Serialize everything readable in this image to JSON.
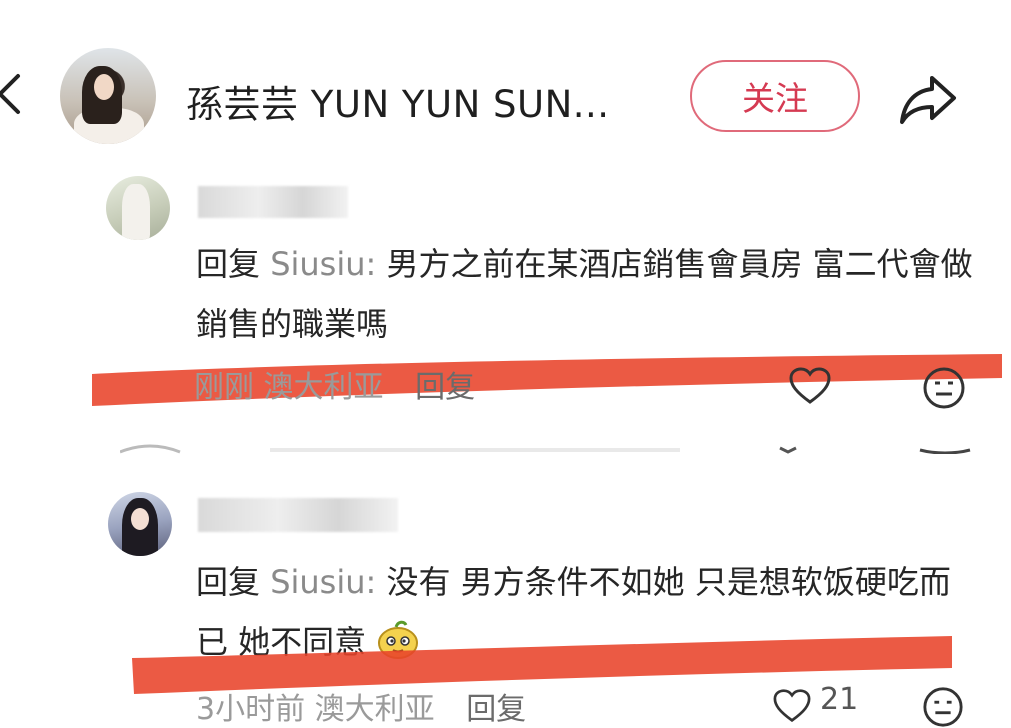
{
  "header": {
    "title": "孫芸芸 YUN YUN SUN...",
    "follow_label": "关注"
  },
  "comments": [
    {
      "reply_prefix": "回复",
      "reply_to": "Siusiu:",
      "text": "男方之前在某酒店銷售會員房 富二代會做銷售的職業嗎",
      "time": "刚刚",
      "location": "澳大利亚",
      "reply_label": "回复",
      "like_count": ""
    },
    {
      "reply_prefix": "回复",
      "reply_to": "Siusiu:",
      "text": "没有 男方条件不如她 只是想软饭硬吃而已 她不同意",
      "time": "3小时前",
      "location": "澳大利亚",
      "reply_label": "回复",
      "like_count": "21"
    }
  ],
  "colors": {
    "follow_border": "#e06a7a",
    "follow_text": "#d53a52",
    "highlight_stroke": "#e8432a"
  },
  "icons": [
    "back-icon",
    "share-icon",
    "heart-icon",
    "smile-icon"
  ]
}
